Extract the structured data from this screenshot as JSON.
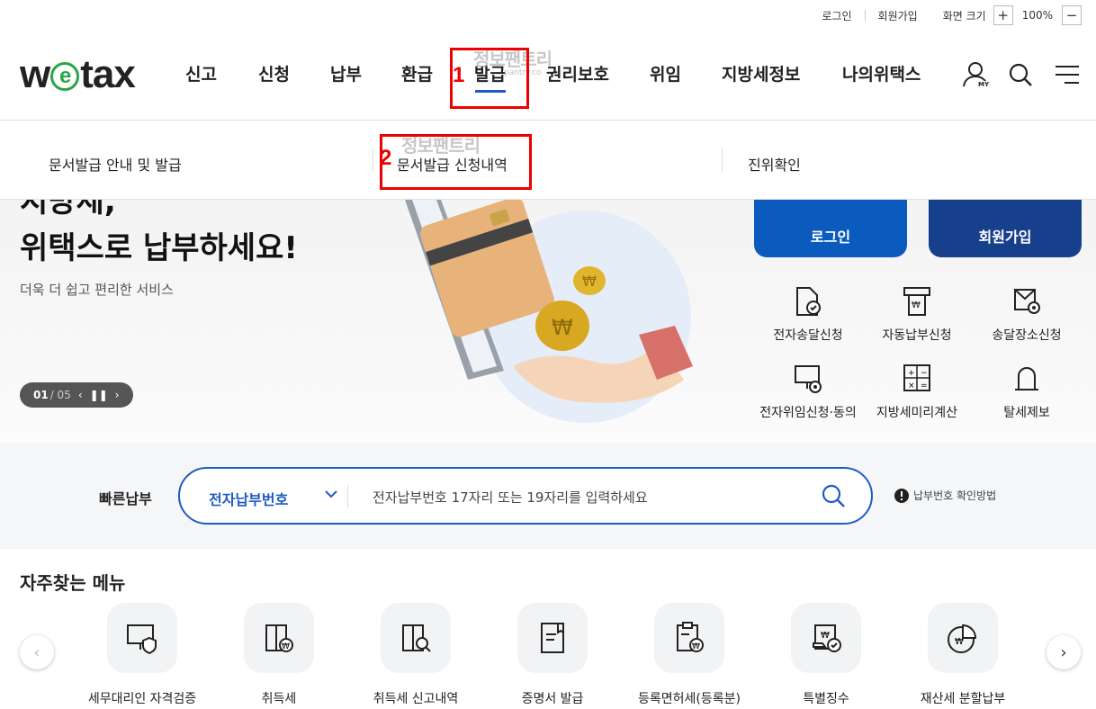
{
  "util": {
    "login": "로그인",
    "join": "회원가입",
    "font_size": "화면 크기",
    "plus": "+",
    "zoom": "100%",
    "minus": "−"
  },
  "logo": {
    "w": "w",
    "e": "e",
    "tax": "tax"
  },
  "nav": [
    "신고",
    "신청",
    "납부",
    "환급",
    "발급",
    "권리보호",
    "위임",
    "지방세정보",
    "나의위택스"
  ],
  "header_icons": {
    "my": "MY"
  },
  "submenu": [
    "문서발급 안내 및 발급",
    "문서발급 신청내역",
    "진위확인"
  ],
  "annotations": {
    "badge1": "1",
    "badge2": "2",
    "watermark": "정보팬트리",
    "watermark_small": "pantry.co"
  },
  "banner": {
    "title1": "지방세,",
    "title2": "위택스로 납부하세요!",
    "subtitle": "더욱 더 쉽고 편리한 서비스",
    "counter": "01",
    "total": "/ 05",
    "login_btn": "로그인",
    "join_btn": "회원가입"
  },
  "quick": [
    "전자송달신청",
    "자동납부신청",
    "송달장소신청",
    "전자위임신청·동의",
    "지방세미리계산",
    "탈세제보"
  ],
  "pay": {
    "label": "빠른납부",
    "select": "전자납부번호",
    "placeholder": "전자납부번호 17자리 또는 19자리를 입력하세요",
    "help": "납부번호 확인방법"
  },
  "favorites": {
    "title": "자주찾는 메뉴",
    "items": [
      "세무대리인 자격검증",
      "취득세",
      "취득세 신고내역",
      "증명서 발급",
      "등록면허세(등록분)",
      "특별징수",
      "재산세 분할납부"
    ]
  },
  "colors": {
    "primary": "#1f5bc6",
    "blue_btn": "#0b5bbf",
    "navy_btn": "#163f8c",
    "annotation": "#e00000",
    "logo_green": "#28a745"
  }
}
